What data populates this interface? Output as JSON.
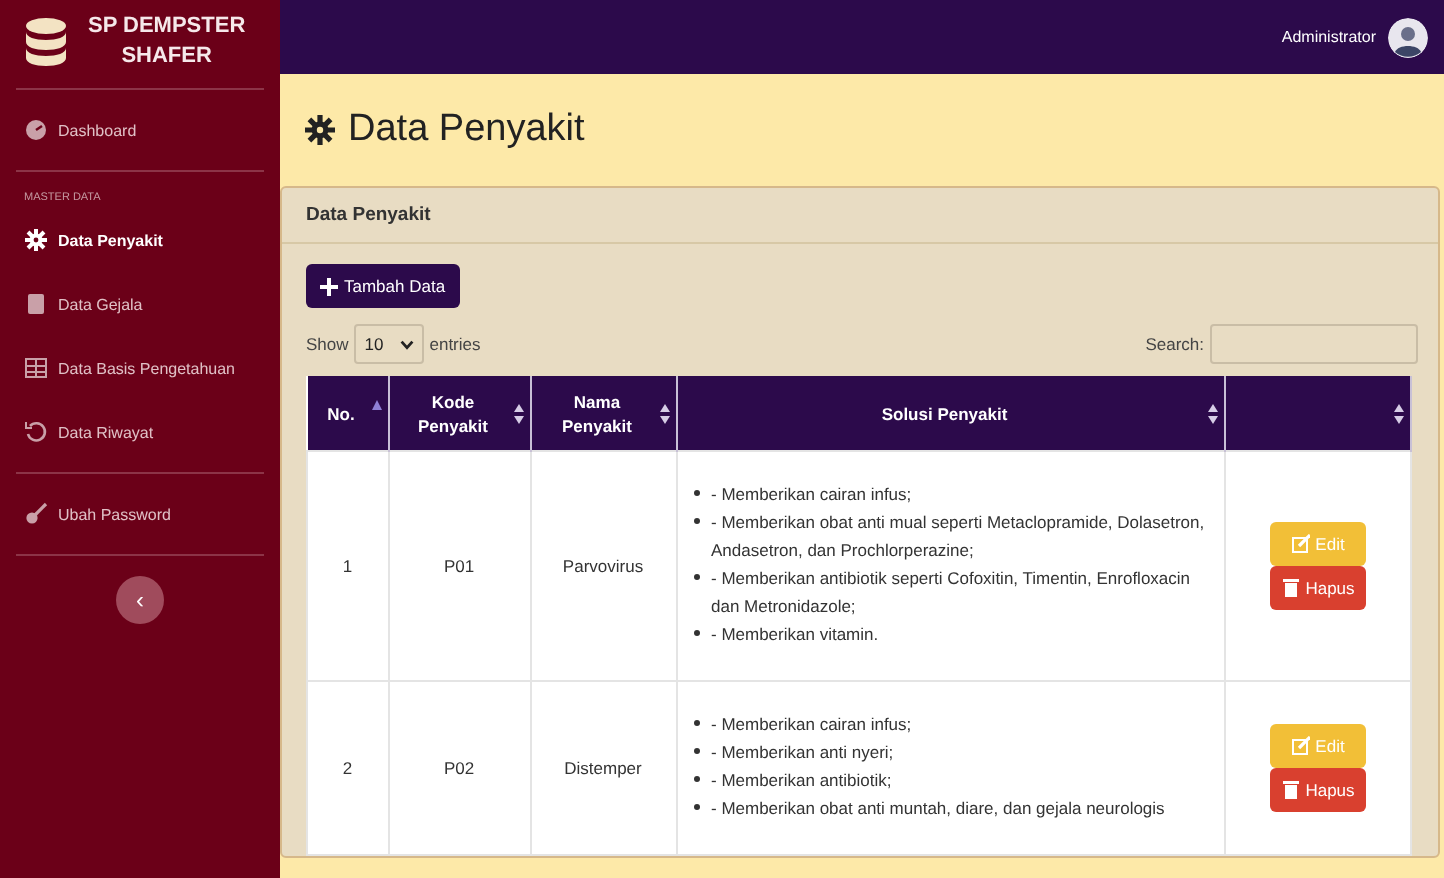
{
  "brand": {
    "line_1": "SP DEMPSTER",
    "line_2": "SHAFER"
  },
  "sidebar": {
    "items": [
      {
        "kind": "link",
        "label": "Dashboard",
        "selected": false
      },
      {
        "kind": "heading",
        "label": "MASTER DATA"
      },
      {
        "kind": "link",
        "label": "Data Penyakit",
        "selected": true
      },
      {
        "kind": "link",
        "label": "Data Gejala",
        "selected": false
      },
      {
        "kind": "link",
        "label": "Data Basis Pengetahuan",
        "selected": false
      },
      {
        "kind": "link",
        "label": "Data Riwayat",
        "selected": false
      },
      {
        "kind": "link",
        "label": "Ubah Password",
        "selected": false
      }
    ],
    "collapse_button": "‹"
  },
  "topbar": {
    "user": "Administrator"
  },
  "page_title": "Data Penyakit",
  "card": {
    "title": "Data Penyakit",
    "add_button": "Tambah Data",
    "length": {
      "before": "Show",
      "value": "10",
      "after": "entries"
    },
    "search": {
      "label": "Search:"
    },
    "table": {
      "columns": [
        {
          "label": "No.",
          "sorted": true
        },
        {
          "label": "Kode Penyakit",
          "sorted": false
        },
        {
          "label": "Nama Penyakit",
          "sorted": false
        },
        {
          "label": "Solusi Penyakit",
          "sorted": false
        },
        {
          "sorted": false
        }
      ],
      "rows": [
        {
          "no": "1",
          "kode": "P01",
          "nama": "Parvovirus",
          "solusi": [
            "- Memberikan cairan infus;",
            "- Memberikan obat anti mual seperti Metaclopramide, Dolasetron, Andasetron, dan Prochlorperazine;",
            "- Memberikan antibiotik seperti Cofoxitin, Timentin, Enrofloxacin dan Metronidazole;",
            "- Memberikan vitamin."
          ],
          "actions": [
            "Edit",
            "Hapus"
          ]
        },
        {
          "no": "2",
          "kode": "P02",
          "nama": "Distemper",
          "solusi": [
            "- Memberikan cairan infus;",
            "- Memberikan anti nyeri;",
            "- Memberikan antibiotik;",
            "- Memberikan obat anti muntah, diare, dan gejala neurologis"
          ],
          "actions": [
            "Edit",
            "Hapus"
          ]
        }
      ]
    }
  }
}
